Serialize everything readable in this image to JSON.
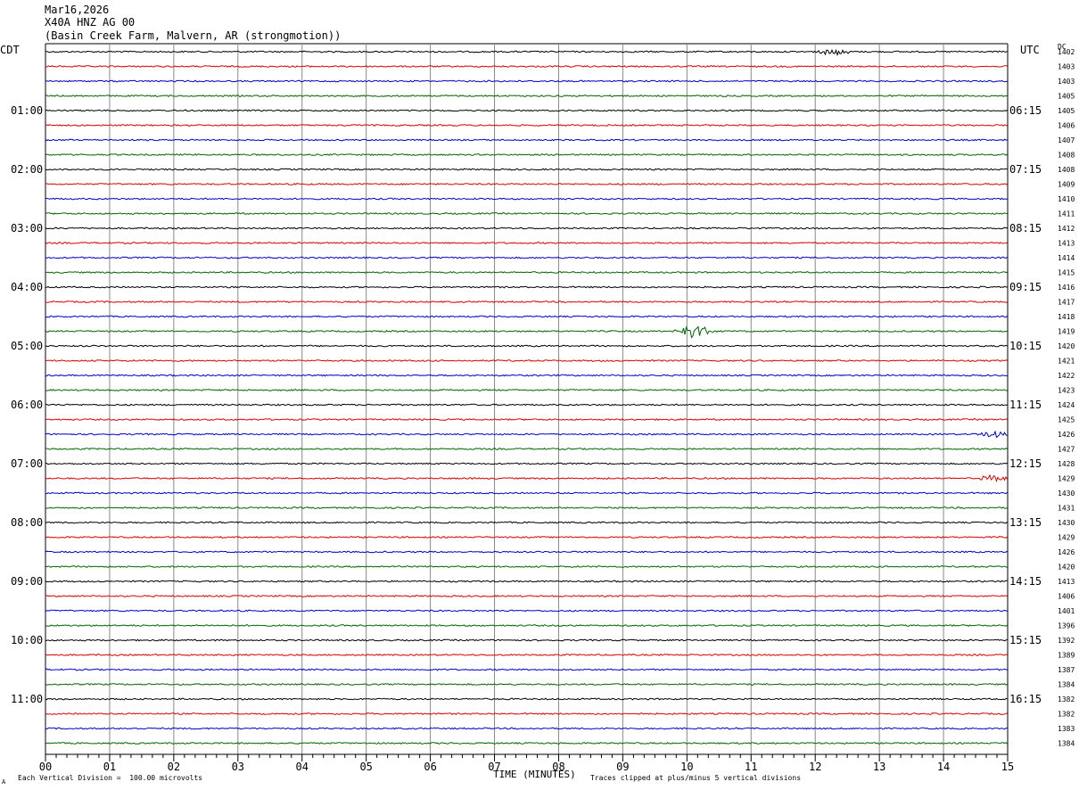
{
  "header": {
    "date": "Mar16,2026",
    "channel": "X40A HNZ AG 00",
    "site": "(Basin Creek Farm, Malvern, AR (strongmotion))"
  },
  "left_zone": "CDT",
  "right_zone": "UTC",
  "dc_header": "DC",
  "footer": {
    "scale_note": "Each Vertical Division =  100.00 microvolts",
    "clip_note": "Traces clipped at plus/minus 5 vertical divisions",
    "mark": "A"
  },
  "colors": {
    "black": "#000000",
    "red": "#dd0000",
    "blue": "#0000cc",
    "green": "#006600",
    "grid": "#888888"
  },
  "chart_data": {
    "type": "line",
    "title": "",
    "xlabel": "TIME (MINUTES)",
    "xlim": [
      0,
      15
    ],
    "x_ticks": [
      "00",
      "01",
      "02",
      "03",
      "04",
      "05",
      "06",
      "07",
      "08",
      "09",
      "10",
      "11",
      "12",
      "13",
      "14",
      "15"
    ],
    "hour_labels_left": [
      "01:00",
      "02:00",
      "03:00",
      "04:00",
      "05:00",
      "06:00",
      "07:00",
      "08:00",
      "09:00",
      "10:00",
      "11:00"
    ],
    "hour_labels_right": [
      "06:15",
      "07:15",
      "08:15",
      "09:15",
      "10:15",
      "11:15",
      "12:15",
      "13:15",
      "14:15",
      "15:15",
      "16:15"
    ],
    "trace_count": 48,
    "trace_minutes": 15,
    "color_cycle": [
      "black",
      "red",
      "blue",
      "green"
    ],
    "dc_offsets": [
      1402,
      1403,
      1403,
      1405,
      1405,
      1406,
      1407,
      1408,
      1408,
      1409,
      1410,
      1411,
      1412,
      1413,
      1414,
      1415,
      1416,
      1417,
      1418,
      1419,
      1420,
      1421,
      1422,
      1423,
      1424,
      1425,
      1426,
      1427,
      1428,
      1429,
      1430,
      1431,
      1430,
      1429,
      1426,
      1420,
      1413,
      1406,
      1401,
      1396,
      1392,
      1389,
      1387,
      1384,
      1382,
      1382,
      1383,
      1384
    ],
    "events": [
      {
        "trace": 0,
        "minute": 12.3,
        "amplitude": "small"
      },
      {
        "trace": 19,
        "minute": 10.1,
        "amplitude": "medium"
      },
      {
        "trace": 26,
        "minute": 14.8,
        "amplitude": "small"
      },
      {
        "trace": 29,
        "minute": 14.8,
        "amplitude": "small"
      }
    ]
  }
}
